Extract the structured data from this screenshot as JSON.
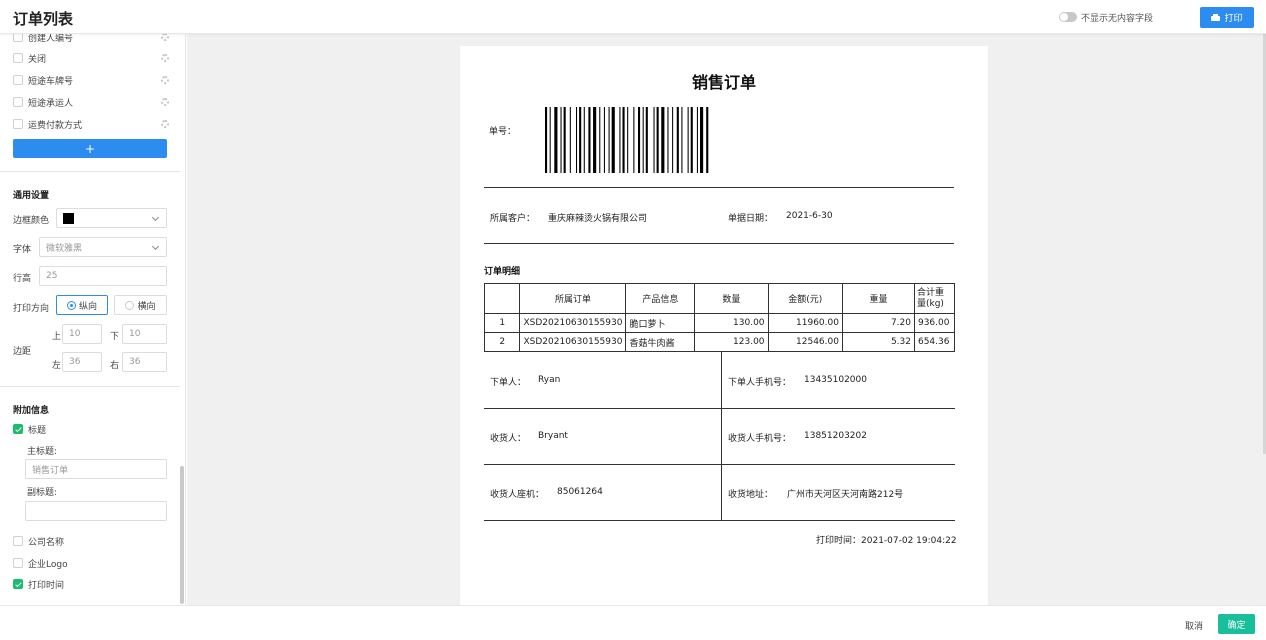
{
  "header": {
    "title": "订单列表",
    "toggle_label": "不显示无内容字段",
    "print_label": "打印"
  },
  "sidebar": {
    "fields": [
      {
        "label": "创建人编号",
        "checked": false
      },
      {
        "label": "关闭",
        "checked": false
      },
      {
        "label": "短途车牌号",
        "checked": false
      },
      {
        "label": "短途承运人",
        "checked": false
      },
      {
        "label": "运费付款方式",
        "checked": false
      }
    ],
    "add_label": "+",
    "general": {
      "title": "通用设置",
      "border_color_label": "边框颜色",
      "border_color": "#000000",
      "font_label": "字体",
      "font_value": "微软雅黑",
      "row_height_label": "行高",
      "row_height_value": "25",
      "direction_label": "打印方向",
      "portrait_label": "纵向",
      "landscape_label": "横向",
      "margin_label": "边距",
      "top_label": "上",
      "top_value": "10",
      "bottom_label": "下",
      "bottom_value": "10",
      "left_label": "左",
      "left_value": "36",
      "right_label": "右",
      "right_value": "36"
    },
    "extra": {
      "title": "附加信息",
      "title_check_label": "标题",
      "main_title_label": "主标题:",
      "main_title_value": "销售订单",
      "sub_title_label": "副标题:",
      "sub_title_value": "",
      "company_label": "公司名称",
      "logo_label": "企业Logo",
      "print_time_label": "打印时间"
    }
  },
  "document": {
    "title": "销售订单",
    "order_no_label": "单号：",
    "customer_label": "所属客户：",
    "customer_value": "重庆麻辣烫火锅有限公司",
    "date_label": "单据日期：",
    "date_value": "2021-6-30",
    "detail_title": "订单明细",
    "columns": [
      "",
      "所属订单",
      "产品信息",
      "数量",
      "金额(元)",
      "重量",
      "合计重量(kg)"
    ],
    "rows": [
      [
        "1",
        "XSD20210630155930",
        "脆口萝卜",
        "130.00",
        "11960.00",
        "7.20",
        "936.00"
      ],
      [
        "2",
        "XSD20210630155930",
        "香菇牛肉酱",
        "123.00",
        "12546.00",
        "5.32",
        "654.36"
      ]
    ],
    "orderer_label": "下单人：",
    "orderer_value": "Ryan",
    "orderer_phone_label": "下单人手机号：",
    "orderer_phone_value": "13435102000",
    "receiver_label": "收货人：",
    "receiver_value": "Bryant",
    "receiver_phone_label": "收货人手机号：",
    "receiver_phone_value": "13851203202",
    "landline_label": "收货人座机：",
    "landline_value": "85061264",
    "address_label": "收货地址：",
    "address_value": "广州市天河区天河南路212号",
    "print_time_label": "打印时间：",
    "print_time_value": "2021-07-02 19:04:22"
  },
  "footer": {
    "cancel_label": "取消",
    "ok_label": "确定"
  },
  "colors": {
    "primary": "#2d8cf0",
    "confirm": "#19be9b",
    "checked": "#19be6b"
  }
}
